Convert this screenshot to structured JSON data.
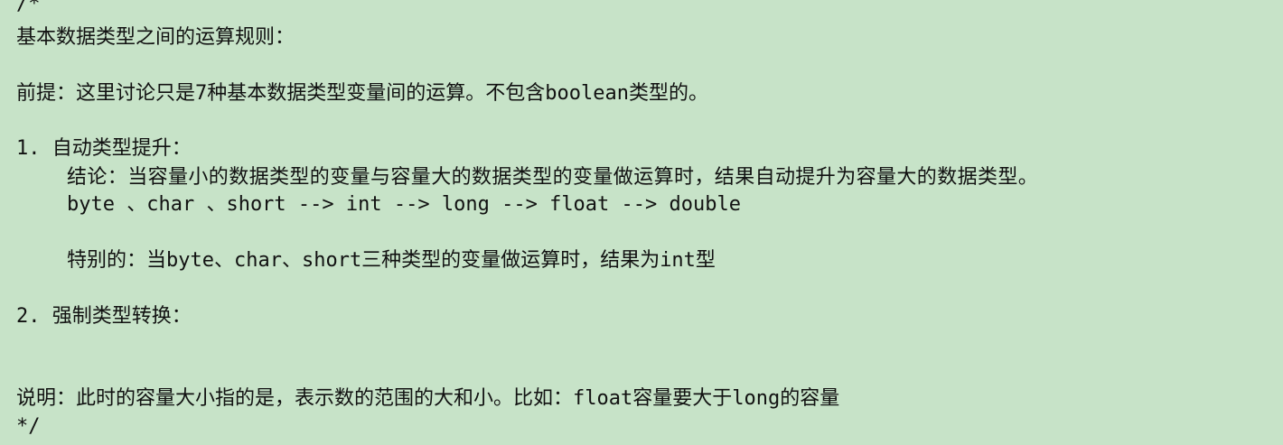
{
  "comment": {
    "open": "/*",
    "heading": "基本数据类型之间的运算规则：",
    "premise": "前提：这里讨论只是7种基本数据类型变量间的运算。不包含boolean类型的。",
    "rule1": {
      "title": "1. 自动类型提升：",
      "conclusion": "结论：当容量小的数据类型的变量与容量大的数据类型的变量做运算时，结果自动提升为容量大的数据类型。",
      "order": "byte 、char 、short --> int --> long --> float --> double",
      "special": "特别的：当byte、char、short三种类型的变量做运算时，结果为int型"
    },
    "rule2": {
      "title": "2. 强制类型转换："
    },
    "note": "说明：此时的容量大小指的是，表示数的范围的大和小。比如：float容量要大于long的容量",
    "close": "*/"
  }
}
